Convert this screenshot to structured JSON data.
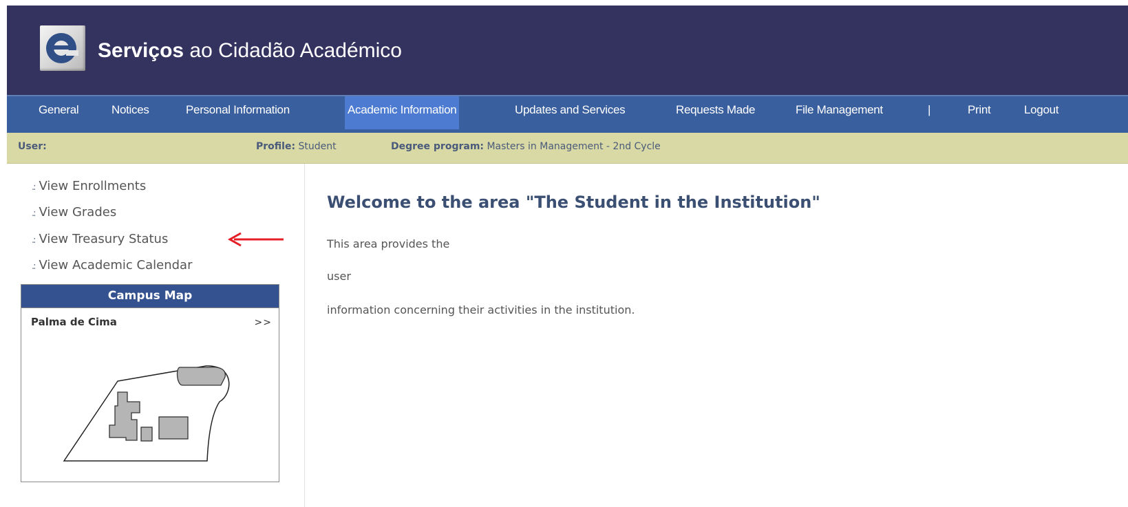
{
  "header": {
    "logo_letter": "e",
    "title_bold": "Serviços",
    "title_rest": " ao Cidadão Académico"
  },
  "nav": {
    "items": [
      {
        "label": "General"
      },
      {
        "label": "Notices"
      },
      {
        "label": "Personal Information"
      },
      {
        "label": "Academic Information",
        "active": true
      },
      {
        "label": "Updates and Services"
      },
      {
        "label": "Requests Made"
      },
      {
        "label": "File Management"
      },
      {
        "label": "|"
      },
      {
        "label": "Print"
      },
      {
        "label": "Logout"
      }
    ]
  },
  "userbar": {
    "user_label": "User:",
    "user_value": "",
    "profile_label": "Profile:",
    "profile_value": " Student",
    "degree_label": "Degree program:",
    "degree_value": " Masters in Management - 2nd Cycle"
  },
  "sidebar": {
    "links": [
      {
        "label": "View Enrollments"
      },
      {
        "label": "View Grades"
      },
      {
        "label": "View Treasury Status"
      },
      {
        "label": "View Academic Calendar"
      }
    ],
    "map": {
      "title": "Campus Map",
      "location": "Palma de Cima",
      "more": ">>"
    }
  },
  "main": {
    "heading": "Welcome to the area \"The Student in the Institution\"",
    "lines": [
      "This area provides the",
      "user",
      "information concerning their activities in the institution."
    ]
  },
  "colors": {
    "header_bg": "#34325f",
    "nav_bg": "#3a5f9e",
    "nav_active": "#4c7bd1",
    "userbar_bg": "#d9d9a6",
    "arrow": "#e51e25"
  }
}
